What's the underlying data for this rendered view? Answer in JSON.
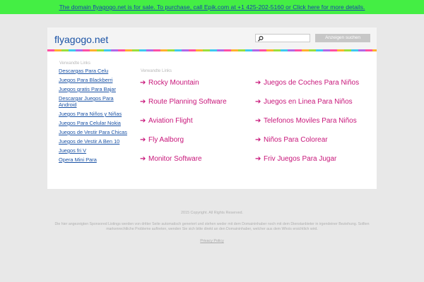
{
  "banner": {
    "text": "The domain flyagogo.net is for sale. To purchase, call Epik.com at +1 425-202-5160 or Click here for more details."
  },
  "header": {
    "logo": "flyagogo.net",
    "search_placeholder": "",
    "search_button": "Anzeigen suchen"
  },
  "sidebar": {
    "heading": "Verwandte Links",
    "items": [
      "Descargas Para Celu",
      "Juegos Para Blackberri",
      "Juegos gratis Para Bajar",
      "Descargar Juegos Para Android",
      "Juegos Para Niños y Niñas",
      "Juegos Para Celular Nokia",
      "Juegos de Vestir Para Chicas",
      "Juegos de Vestir A Ben 10",
      "Juegos fri V",
      "Opera Mini Para"
    ]
  },
  "main": {
    "heading": "Verwandte Links",
    "links_left": [
      "Rocky Mountain",
      "Route Planning Software",
      "Aviation Flight",
      "Fly Aalborg",
      "Monitor Software"
    ],
    "links_right": [
      "Juegos de Coches Para Niños",
      "Juegos en Linea Para Niños",
      "Telefonos Moviles Para Niños",
      "Niños Para Colorear",
      "Friv Juegos Para Jugar"
    ],
    "arrow": "➔"
  },
  "footer": {
    "copyright": "2015 Copyright. All Rights Reserved.",
    "disclaimer": "Die hier angezeigten Sponsored Listings werden von dritter Seite automatisch generiert und stehen weder mit dem Domaininhaber noch mit dem Dienstanbieter in irgendeiner Beziehung. Sollten markenrechtliche Probleme auftreten, wenden Sie sich bitte direkt an den Domaininhaber, welcher aus dem Whois ersichtlich wird.",
    "privacy": "Privacy Policy"
  },
  "colors": {
    "banner_bg": "#44ee44",
    "link_blue": "#1a52a5",
    "link_pink": "#c8167a",
    "page_bg": "#e8e8e8"
  }
}
